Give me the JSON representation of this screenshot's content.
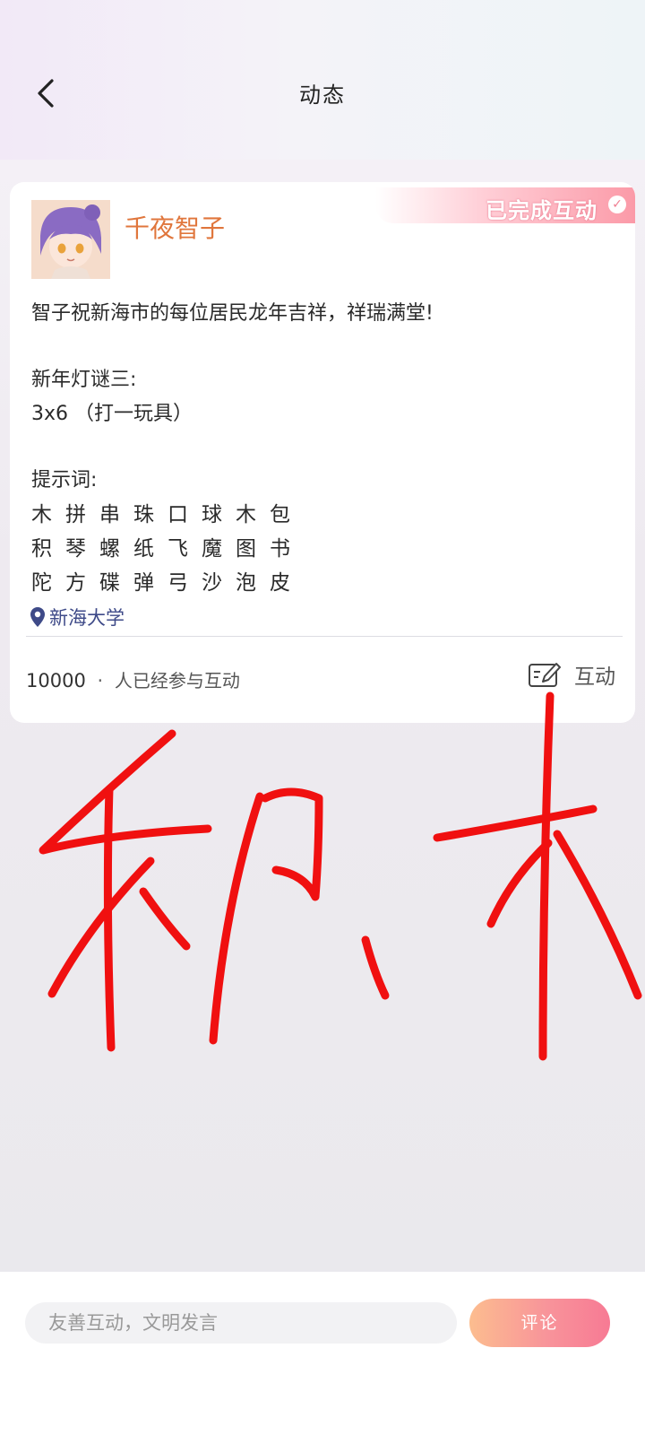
{
  "header": {
    "back_icon": "chevron-left-icon",
    "title": "动态"
  },
  "post": {
    "username": "千夜智子",
    "avatar_icon": "anime-avatar",
    "badge": "已完成互动",
    "badge_icon": "check-circle-icon",
    "lines": [
      "智子祝新海市的每位居民龙年吉祥，祥瑞满堂!",
      "新年灯谜三:",
      "3x6 （打一玩具）",
      "提示词:"
    ],
    "hint_rows": [
      [
        "木",
        "拼",
        "串",
        "珠",
        "口",
        "球",
        "木",
        "包"
      ],
      [
        "积",
        "琴",
        "螺",
        "纸",
        "飞",
        "魔",
        "图",
        "书"
      ],
      [
        "陀",
        "方",
        "碟",
        "弹",
        "弓",
        "沙",
        "泡",
        "皮"
      ]
    ],
    "location_icon": "location-pin-icon",
    "location": "新海大学",
    "participant_count": "10000",
    "participant_sep": "·",
    "participant_text": "人已经参与互动",
    "interact_icon": "edit-note-icon",
    "interact_label": "互动"
  },
  "handwriting": {
    "text": "积木",
    "color": "#f01010"
  },
  "bottom": {
    "comment_placeholder": "友善互动，文明发言",
    "comment_button": "评论"
  },
  "colors": {
    "username": "#e0763c",
    "location": "#3e4a88",
    "accent_gradient_start": "#fcbd8f",
    "accent_gradient_end": "#f77a94"
  }
}
